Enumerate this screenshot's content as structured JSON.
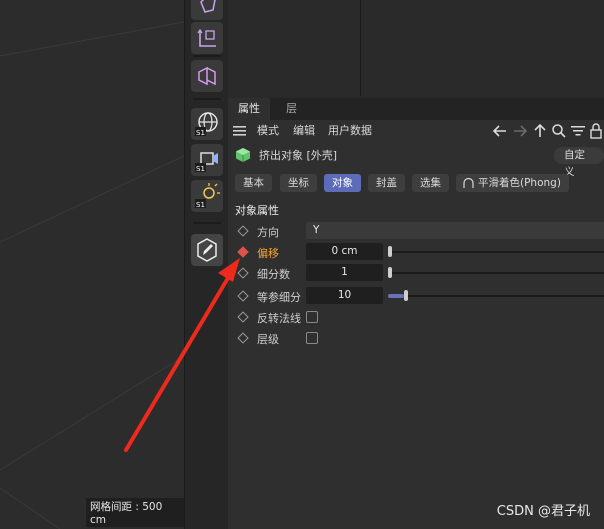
{
  "viewport": {
    "grid_label": "网格间距 : 500 cm"
  },
  "panel": {
    "tabs": [
      {
        "label": "属性"
      },
      {
        "label": "层"
      }
    ],
    "menu": [
      {
        "label": "模式"
      },
      {
        "label": "编辑"
      },
      {
        "label": "用户数据"
      }
    ],
    "object_name": "挤出对象 [外壳]",
    "custom_button": "自定义",
    "subtabs": [
      {
        "label": "基本"
      },
      {
        "label": "坐标"
      },
      {
        "label": "对象"
      },
      {
        "label": "封盖"
      },
      {
        "label": "选集"
      },
      {
        "label": "平滑着色(Phong)"
      }
    ],
    "section_title": "对象属性",
    "properties": [
      {
        "label": "方向",
        "value": "Y"
      },
      {
        "label": "偏移",
        "value": "0 cm"
      },
      {
        "label": "细分数",
        "value": "1"
      },
      {
        "label": "等参细分",
        "value": "10"
      },
      {
        "label": "反转法线"
      },
      {
        "label": "层级"
      }
    ]
  },
  "colors": {
    "accent": "#5c6cba",
    "highlight": "#f0a235",
    "keyframe": "#e0524b",
    "arrow": "#ee2a1c"
  },
  "watermark": "CSDN @君子机"
}
